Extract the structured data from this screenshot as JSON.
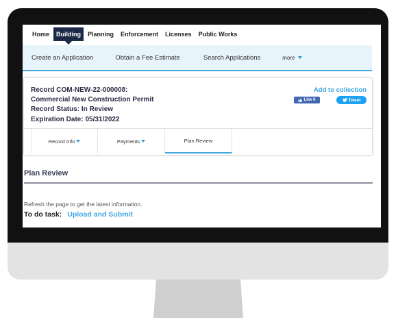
{
  "top_nav": [
    "Home",
    "Building",
    "Planning",
    "Enforcement",
    "Licenses",
    "Public Works"
  ],
  "top_nav_active": "Building",
  "sub_nav": {
    "create": "Create an Application",
    "fee": "Obtain a Fee Estimate",
    "search": "Search Applications",
    "more": "more"
  },
  "record": {
    "number": "Record COM-NEW-22-000008:",
    "type": "Commercial New Construction Permit",
    "status": "Record Status: In Review",
    "expiration": "Expiration Date: 05/31/2022",
    "add_to_collection": "Add to collection",
    "like_label": "Like 0",
    "tweet_label": "Tweet"
  },
  "tabs": [
    {
      "label": "Record Info",
      "dropdown": true
    },
    {
      "label": "Payments",
      "dropdown": true
    },
    {
      "label": "Plan Review",
      "dropdown": false,
      "active": true
    }
  ],
  "section": {
    "title": "Plan Review",
    "refresh_note": "Refresh the page to get the latest information.",
    "todo_label": "To do task:",
    "todo_link": "Upload and Submit"
  },
  "colors": {
    "accent": "#3fa9dd",
    "link": "#3ca7e5",
    "nav_active": "#1c2a48",
    "subnav_bg": "#e7f4fb",
    "facebook": "#4267b2",
    "twitter": "#1da1f2"
  },
  "icons": [
    "thumbs-up-icon",
    "twitter-bird-icon",
    "dropdown-caret-icon"
  ]
}
